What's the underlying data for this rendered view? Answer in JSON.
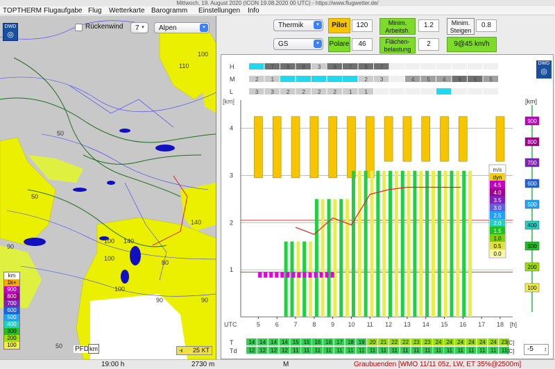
{
  "window": {
    "title": "Mittwoch, 19. August 2020 (ICON 19.08.2020 00 UTC) - https://www.flugwetter.de/"
  },
  "menu": [
    "TOPTHERM",
    "Flugaufgabe",
    "Flug",
    "Wetterkarte",
    "Barogramm",
    "Einstellungen",
    "Info"
  ],
  "map": {
    "rueckenwind_label": "Rückenwind",
    "rueckenwind_value": "7",
    "region_select": "Alpen",
    "contour_labels": [
      "110",
      "100",
      "50",
      "90",
      "50",
      "140",
      "100",
      "140",
      "100",
      "80",
      "90",
      "90",
      "100",
      "50"
    ],
    "legend_title": "km",
    "legend": [
      {
        "label": "1k+",
        "color": "#f5a800"
      },
      {
        "label": "900",
        "color": "#c000c0"
      },
      {
        "label": "800",
        "color": "#a00090"
      },
      {
        "label": "700",
        "color": "#8020c0"
      },
      {
        "label": "600",
        "color": "#2060e0"
      },
      {
        "label": "500",
        "color": "#20a0ff"
      },
      {
        "label": "400",
        "color": "#20d0c0"
      },
      {
        "label": "300",
        "color": "#20c020"
      },
      {
        "label": "200",
        "color": "#a0e000"
      },
      {
        "label": "100",
        "color": "#f0f040"
      }
    ],
    "pfd_label": "PFD",
    "km_label": "km",
    "wind_label": "25 KT"
  },
  "controls": {
    "thermik_select": "Thermik",
    "gs_select": "GS",
    "pilot_label": "Pilot",
    "pilot_value": "120",
    "polare_label": "Polare",
    "polare_value": "46",
    "min_arbeit_label": "Minim.\nArbeitsh.",
    "min_arbeit_value": "1.2",
    "min_steigen_label": "Minim.\nSteigen",
    "min_steigen_value": "0.8",
    "flaechen_label": "Flächen-\nbelastung",
    "flaechen_value": "2",
    "result": "9@45 km/h"
  },
  "chart": {
    "layer_labels": [
      "H",
      "M",
      "L"
    ],
    "h_row": [
      "",
      "7",
      "8",
      "8",
      "3",
      "8",
      "7",
      "8",
      "7",
      "",
      "",
      "",
      "",
      "",
      "",
      ""
    ],
    "m_row": [
      "2",
      "1",
      "",
      "",
      "",
      "",
      "",
      "2",
      "3",
      "",
      "4",
      "5",
      "4",
      "6",
      "6",
      "5"
    ],
    "l_row": [
      "3",
      "3",
      "2",
      "2",
      "2",
      "2",
      "1",
      "1",
      "",
      "",
      "",
      "",
      "",
      "",
      "",
      ""
    ],
    "y_unit": "[km]",
    "y_ticks": [
      "1",
      "2",
      "3",
      "4"
    ],
    "x_label": "UTC",
    "x_ticks": [
      "5",
      "6",
      "7",
      "8",
      "9",
      "10",
      "11",
      "12",
      "13",
      "14",
      "15",
      "16",
      "17",
      "18"
    ],
    "x_unit": "[h]",
    "right_scale_unit": "[km]",
    "right_scale": [
      {
        "label": "900",
        "color": "#c000c0"
      },
      {
        "label": "800",
        "color": "#a00090"
      },
      {
        "label": "700",
        "color": "#8020c0"
      },
      {
        "label": "600",
        "color": "#2060e0"
      },
      {
        "label": "500",
        "color": "#20a0ff"
      },
      {
        "label": "400",
        "color": "#20d0c0"
      },
      {
        "label": "300",
        "color": "#20c020"
      },
      {
        "label": "200",
        "color": "#a0e000"
      },
      {
        "label": "100",
        "color": "#f0f040"
      }
    ],
    "ms_legend_title": "m/s",
    "ms_legend": [
      {
        "label": "dyn",
        "color": "#f5d000"
      },
      {
        "label": "4.5",
        "color": "#c000c0"
      },
      {
        "label": "4.0",
        "color": "#a00090"
      },
      {
        "label": "3.5",
        "color": "#8020c0"
      },
      {
        "label": "3.0",
        "color": "#6060e0"
      },
      {
        "label": "2.5",
        "color": "#20a0ff"
      },
      {
        "label": "2.0",
        "color": "#20d0c0"
      },
      {
        "label": "1.5",
        "color": "#20c020"
      },
      {
        "label": "1.0",
        "color": "#80d000"
      },
      {
        "label": "0.5",
        "color": "#e0e040"
      },
      {
        "label": "0.0",
        "color": "#f8f8a0"
      }
    ],
    "t_label": "T",
    "td_label": "Td",
    "t_row": [
      "14",
      "14",
      "14",
      "14",
      "15",
      "15",
      "16",
      "16",
      "17",
      "18",
      "19",
      "20",
      "21",
      "22",
      "22",
      "23",
      "23",
      "24",
      "24",
      "24",
      "24",
      "24",
      "24",
      "23"
    ],
    "td_row": [
      "12",
      "12",
      "12",
      "12",
      "11",
      "11",
      "11",
      "11",
      "11",
      "11",
      "11",
      "11",
      "11",
      "11",
      "11",
      "11",
      "11",
      "11",
      "11",
      "11",
      "11",
      "11",
      "11",
      "11"
    ],
    "deg_unit": "[C]",
    "stepper_value": "-5"
  },
  "status": {
    "time": "19:00 h",
    "altitude": "2730 m",
    "mode": "M",
    "station": "Graubuenden [WMO 11/11 05z, LW, ET  35%@2500m]"
  },
  "dwd_label": "DWD"
}
